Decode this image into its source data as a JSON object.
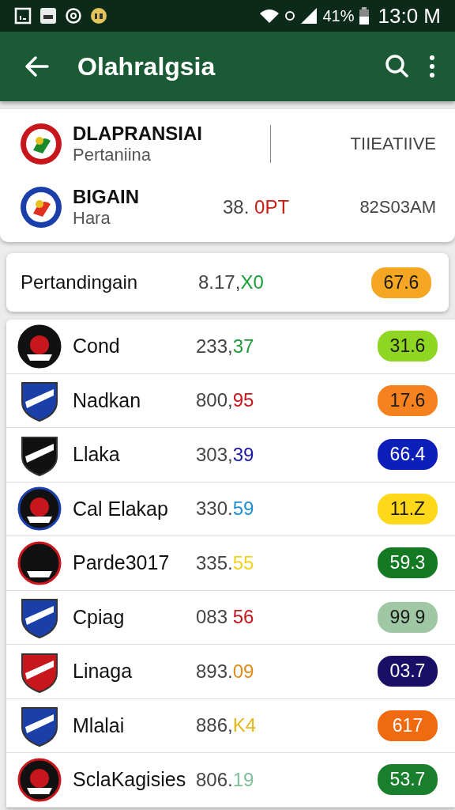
{
  "status_bar": {
    "battery": "41%",
    "time": "13:0 M"
  },
  "app_bar": {
    "title": "Olahralgsia"
  },
  "header": {
    "rows": [
      {
        "name": "DLAPRANSIAI",
        "sub": "Pertaniina",
        "right": "TIIEATIIVE",
        "divider": true
      },
      {
        "name": "BIGAIN",
        "sub": "Hara",
        "score": {
          "main": "38. ",
          "accent": "0PT",
          "color": "#cc1a12"
        },
        "right": "82S03AM",
        "divider": false
      }
    ]
  },
  "summary": {
    "label": "Pertandingain",
    "score": {
      "main": "8.17,",
      "accent": "X0",
      "color": "#18a038"
    },
    "badge": "67.6",
    "color": "#f5a623"
  },
  "teams": [
    {
      "name": "Cond",
      "kind": "circle",
      "score": {
        "main": "233,",
        "accent": "37",
        "color": "#1e9a3a"
      },
      "badge": "31.6",
      "color": "#8fd622"
    },
    {
      "name": "Nadkan",
      "kind": "shield",
      "score": {
        "main": "800,",
        "accent": "95",
        "color": "#c8161d"
      },
      "badge": "17.6",
      "color": "#f5811f"
    },
    {
      "name": "Llaka",
      "kind": "shield",
      "score": {
        "main": "303,",
        "accent": "39",
        "color": "#1a1aa8"
      },
      "badge": "66.4",
      "color": "#0c1fb8"
    },
    {
      "name": "Cal Elakap",
      "kind": "circle",
      "score": {
        "main": "330.",
        "accent": "59",
        "color": "#1e8fd0"
      },
      "badge": "11.Z",
      "color": "#ffd81a"
    },
    {
      "name": "Parde3017",
      "kind": "circle",
      "score": {
        "main": "335.",
        "accent": "55",
        "color": "#f2d21c"
      },
      "badge": "59.3",
      "color": "#137a23"
    },
    {
      "name": "Cpiag",
      "kind": "shield",
      "score": {
        "main": "083 ",
        "accent": "56",
        "color": "#c8161d"
      },
      "badge": "99 9",
      "color": "#9fc7a4"
    },
    {
      "name": "Linaga",
      "kind": "shield",
      "score": {
        "main": "893.",
        "accent": "09",
        "color": "#e08a18"
      },
      "badge": "03.7",
      "color": "#1a0f66"
    },
    {
      "name": "Mlalai",
      "kind": "shield",
      "score": {
        "main": "886,",
        "accent": "K4",
        "color": "#e6b81a"
      },
      "badge": "617",
      "color": "#f06a10"
    },
    {
      "name": "SclaKagisies",
      "kind": "circle",
      "score": {
        "main": "806.",
        "accent": "19",
        "color": "#7fbf9a"
      },
      "badge": "53.7",
      "color": "#1a7f2c"
    }
  ]
}
